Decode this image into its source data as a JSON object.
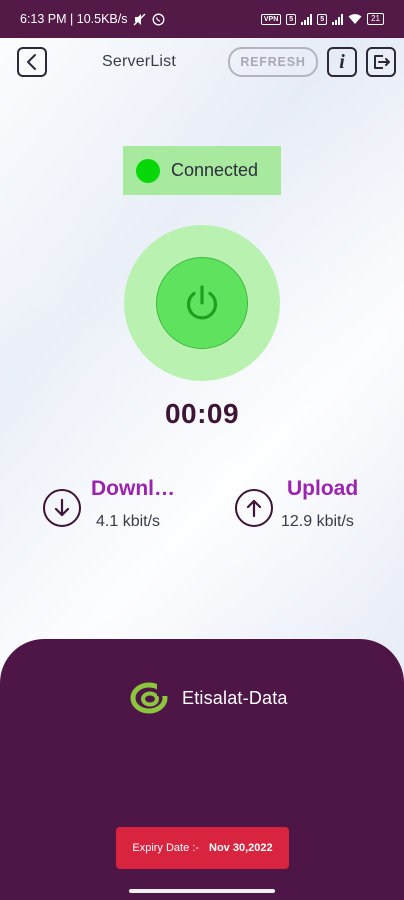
{
  "status_bar": {
    "time_info": "6:13 PM | 10.5KB/s",
    "vpn_badge": "VPN",
    "sim_badge": "5",
    "battery": "21"
  },
  "topbar": {
    "title": "ServerList",
    "refresh_label": "REFRESH",
    "info_label": "i"
  },
  "connection": {
    "status_text": "Connected",
    "status_color": "#08d80a",
    "timer": "00:09"
  },
  "stats": {
    "download": {
      "label": "Downl…",
      "value": "4.1 kbit/s"
    },
    "upload": {
      "label": "Upload",
      "value": "12.9 kbit/s"
    }
  },
  "provider": {
    "name": "Etisalat-Data"
  },
  "expiry": {
    "label": "Expiry Date :-",
    "date": "Nov 30,2022"
  },
  "colors": {
    "accent_purple": "#4e1646",
    "stat_title": "#9b23b0",
    "power_green": "#5fe35f",
    "expiry_red": "#d8243f"
  }
}
